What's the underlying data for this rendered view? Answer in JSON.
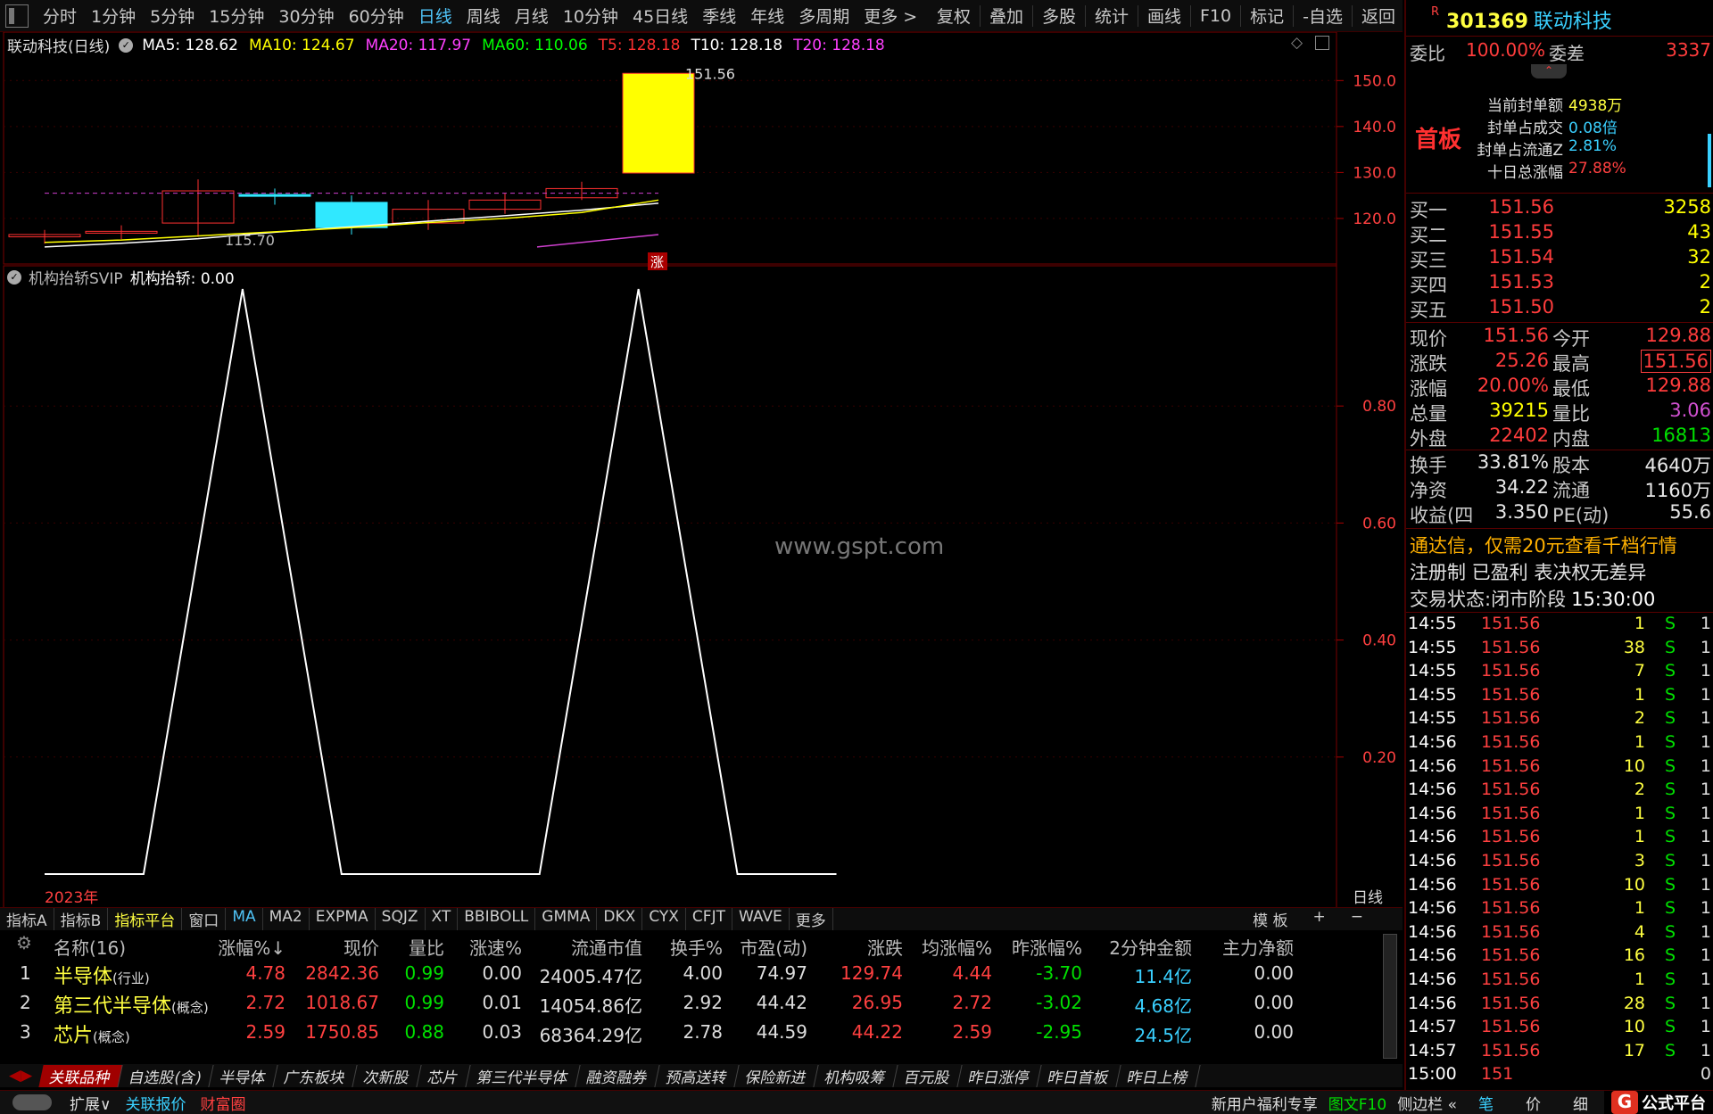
{
  "topbar": {
    "periods": [
      "分时",
      "1分钟",
      "5分钟",
      "15分钟",
      "30分钟",
      "60分钟",
      "日线",
      "周线",
      "月线",
      "10分钟",
      "45日线",
      "季线",
      "年线",
      "多周期",
      "更多 >"
    ],
    "selected": "日线",
    "tools": [
      "复权",
      "叠加",
      "多股",
      "统计",
      "画线",
      "F10",
      "标记",
      "-自选",
      "返回"
    ]
  },
  "main_chart": {
    "stock_title": "联动科技(日线)",
    "ma": [
      {
        "label": "MA5: 128.62",
        "color": "#ffffff"
      },
      {
        "label": "MA10: 124.67",
        "color": "#ffff00"
      },
      {
        "label": "MA20: 117.97",
        "color": "#ff40ff"
      },
      {
        "label": "MA60: 110.06",
        "color": "#00ff00"
      },
      {
        "label": "T5: 128.18",
        "color": "#ff3030"
      },
      {
        "label": "T10: 128.18",
        "color": "#ffffff"
      },
      {
        "label": "T20: 128.18",
        "color": "#ff40ff"
      }
    ],
    "y_ticks": [
      "150.0",
      "140.0",
      "130.0",
      "120.0"
    ],
    "high_label": "151.56",
    "low_label": "115.70",
    "limit_up_badge": "涨"
  },
  "indicator": {
    "title": "机构抬轿SVIP",
    "value_label": "机构抬轿: 0.00",
    "y_ticks": [
      "0.80",
      "0.60",
      "0.40",
      "0.20"
    ],
    "year_label": "2023年",
    "period_label": "日线",
    "watermark": "www.gspt.com"
  },
  "chart_data": [
    {
      "type": "candlestick",
      "title": "联动科技(日线)",
      "ylim": [
        113,
        152
      ],
      "candles": [
        {
          "o": 116.0,
          "c": 116.5,
          "h": 117.5,
          "l": 114.5
        },
        {
          "o": 116.8,
          "c": 117.2,
          "h": 118.5,
          "l": 115.5
        },
        {
          "o": 119.0,
          "c": 126.0,
          "h": 128.5,
          "l": 116.0
        },
        {
          "o": 125.2,
          "c": 125.0,
          "h": 126.5,
          "l": 123.0
        },
        {
          "o": 123.5,
          "c": 118.0,
          "h": 125.0,
          "l": 116.5
        },
        {
          "o": 119.0,
          "c": 122.0,
          "h": 124.0,
          "l": 117.5
        },
        {
          "o": 122.0,
          "c": 124.0,
          "h": 125.5,
          "l": 121.0
        },
        {
          "o": 124.5,
          "c": 126.5,
          "h": 128.0,
          "l": 124.0
        },
        {
          "o": 129.88,
          "c": 151.56,
          "h": 151.56,
          "l": 129.88
        }
      ]
    },
    {
      "type": "line",
      "title": "机构抬轿SVIP",
      "ylim": [
        0,
        1
      ],
      "values": [
        0,
        0,
        1,
        0,
        0,
        0,
        1,
        0,
        0
      ]
    }
  ],
  "right": {
    "code": "301369",
    "name": "联动科技",
    "webi_label": "委比",
    "webi_val": "100.00%",
    "weicha_label": "委差",
    "weicha_val": "3337",
    "shouban": "首板",
    "seal": [
      {
        "k": "当前封单额",
        "v": "4938万"
      },
      {
        "k": "封单占成交",
        "v": "0.08倍"
      },
      {
        "k": "封单占流通Z",
        "v": "2.81%"
      },
      {
        "k": "十日总涨幅",
        "v": "27.88%"
      }
    ],
    "bids": [
      {
        "k": "买一",
        "p": "151.56",
        "v": "3258"
      },
      {
        "k": "买二",
        "p": "151.55",
        "v": "43"
      },
      {
        "k": "买三",
        "p": "151.54",
        "v": "32"
      },
      {
        "k": "买四",
        "p": "151.53",
        "v": "2"
      },
      {
        "k": "买五",
        "p": "151.50",
        "v": "2"
      }
    ],
    "quote": [
      {
        "k1": "现价",
        "v1": "151.56",
        "k2": "今开",
        "v2": "129.88"
      },
      {
        "k1": "涨跌",
        "v1": "25.26",
        "k2": "最高",
        "v2": "151.56"
      },
      {
        "k1": "涨幅",
        "v1": "20.00%",
        "k2": "最低",
        "v2": "129.88"
      },
      {
        "k1": "总量",
        "v1": "39215",
        "k2": "量比",
        "v2": "3.06"
      },
      {
        "k1": "外盘",
        "v1": "22402",
        "k2": "内盘",
        "v2": "16813"
      }
    ],
    "fund": [
      {
        "k1": "换手",
        "v1": "33.81%",
        "k2": "股本",
        "v2": "4640万"
      },
      {
        "k1": "净资",
        "v1": "34.22",
        "k2": "流通",
        "v2": "1160万"
      },
      {
        "k1": "收益(四",
        "v1": "3.350",
        "k2": "PE(动)",
        "v2": "55.6"
      }
    ],
    "promo": "通达信，仅需20元查看千档行情",
    "reg": "注册制 已盈利 表决权无差异",
    "trade_status_label": "交易状态:",
    "trade_status": "闭市阶段",
    "trade_time": "15:30:00",
    "ticks": [
      {
        "t": "14:55",
        "p": "151.56",
        "v": "1",
        "s": "S",
        "n": "1"
      },
      {
        "t": "14:55",
        "p": "151.56",
        "v": "38",
        "s": "S",
        "n": "1"
      },
      {
        "t": "14:55",
        "p": "151.56",
        "v": "7",
        "s": "S",
        "n": "1"
      },
      {
        "t": "14:55",
        "p": "151.56",
        "v": "1",
        "s": "S",
        "n": "1"
      },
      {
        "t": "14:55",
        "p": "151.56",
        "v": "2",
        "s": "S",
        "n": "1"
      },
      {
        "t": "14:56",
        "p": "151.56",
        "v": "1",
        "s": "S",
        "n": "1"
      },
      {
        "t": "14:56",
        "p": "151.56",
        "v": "10",
        "s": "S",
        "n": "1"
      },
      {
        "t": "14:56",
        "p": "151.56",
        "v": "2",
        "s": "S",
        "n": "1"
      },
      {
        "t": "14:56",
        "p": "151.56",
        "v": "1",
        "s": "S",
        "n": "1"
      },
      {
        "t": "14:56",
        "p": "151.56",
        "v": "1",
        "s": "S",
        "n": "1"
      },
      {
        "t": "14:56",
        "p": "151.56",
        "v": "3",
        "s": "S",
        "n": "1"
      },
      {
        "t": "14:56",
        "p": "151.56",
        "v": "10",
        "s": "S",
        "n": "1"
      },
      {
        "t": "14:56",
        "p": "151.56",
        "v": "1",
        "s": "S",
        "n": "1"
      },
      {
        "t": "14:56",
        "p": "151.56",
        "v": "4",
        "s": "S",
        "n": "1"
      },
      {
        "t": "14:56",
        "p": "151.56",
        "v": "16",
        "s": "S",
        "n": "1"
      },
      {
        "t": "14:56",
        "p": "151.56",
        "v": "1",
        "s": "S",
        "n": "1"
      },
      {
        "t": "14:56",
        "p": "151.56",
        "v": "28",
        "s": "S",
        "n": "1"
      },
      {
        "t": "14:57",
        "p": "151.56",
        "v": "10",
        "s": "S",
        "n": "1"
      },
      {
        "t": "14:57",
        "p": "151.56",
        "v": "17",
        "s": "S",
        "n": "1"
      },
      {
        "t": "15:00",
        "p": "151",
        "v": "",
        "s": "",
        "n": "0"
      }
    ],
    "bottom_tabs": [
      "笔",
      "价",
      "细"
    ]
  },
  "indtabs": {
    "items": [
      "指标A",
      "指标B",
      "指标平台",
      "窗口",
      "MA",
      "MA2",
      "EXPMA",
      "SQJZ",
      "XT",
      "BBIBOLL",
      "GMMA",
      "DKX",
      "CYX",
      "CFJT",
      "WAVE",
      "更多"
    ],
    "right": [
      "模 板",
      "+",
      "−"
    ]
  },
  "table": {
    "headers": [
      "名称(16)",
      "涨幅%↓",
      "现价",
      "量比",
      "涨速%",
      "流通市值",
      "换手%",
      "市盈(动)",
      "涨跌",
      "均涨幅%",
      "昨涨幅%",
      "2分钟金额",
      "主力净额"
    ],
    "rows": [
      {
        "idx": "1",
        "name": "半导体",
        "tag": "(行业)",
        "zf": "4.78",
        "xj": "2842.36",
        "lb": "0.99",
        "zs": "0.00",
        "lt": "24005.47亿",
        "hs": "4.00",
        "sy": "74.97",
        "zd": "129.74",
        "jz": "4.44",
        "zr": "-3.70",
        "je": "11.4亿",
        "zl": "0.00"
      },
      {
        "idx": "2",
        "name": "第三代半导体",
        "tag": "(概念)",
        "zf": "2.72",
        "xj": "1018.67",
        "lb": "0.99",
        "zs": "0.01",
        "lt": "14054.86亿",
        "hs": "2.92",
        "sy": "44.42",
        "zd": "26.95",
        "jz": "2.72",
        "zr": "-3.02",
        "je": "4.68亿",
        "zl": "0.00"
      },
      {
        "idx": "3",
        "name": "芯片",
        "tag": "(概念)",
        "zf": "2.59",
        "xj": "1750.85",
        "lb": "0.88",
        "zs": "0.03",
        "lt": "68364.29亿",
        "hs": "2.78",
        "sy": "44.59",
        "zd": "44.22",
        "jz": "2.59",
        "zr": "-2.95",
        "je": "24.5亿",
        "zl": "0.00"
      }
    ]
  },
  "bottomtabs": [
    "关联品种",
    "自选股(含)",
    "半导体",
    "广东板块",
    "次新股",
    "芯片",
    "第三代半导体",
    "融资融券",
    "预高送转",
    "保险新进",
    "机构吸筹",
    "百元股",
    "昨日涨停",
    "昨日首板",
    "昨日上榜"
  ],
  "statusbar": {
    "left": [
      "扩展∨",
      "关联报价",
      "财富圈"
    ],
    "right": [
      "新用户福利专享",
      "图文F10",
      "侧边栏 «"
    ],
    "logo": "公式平台",
    "logo_url": "www.gspt.com"
  }
}
